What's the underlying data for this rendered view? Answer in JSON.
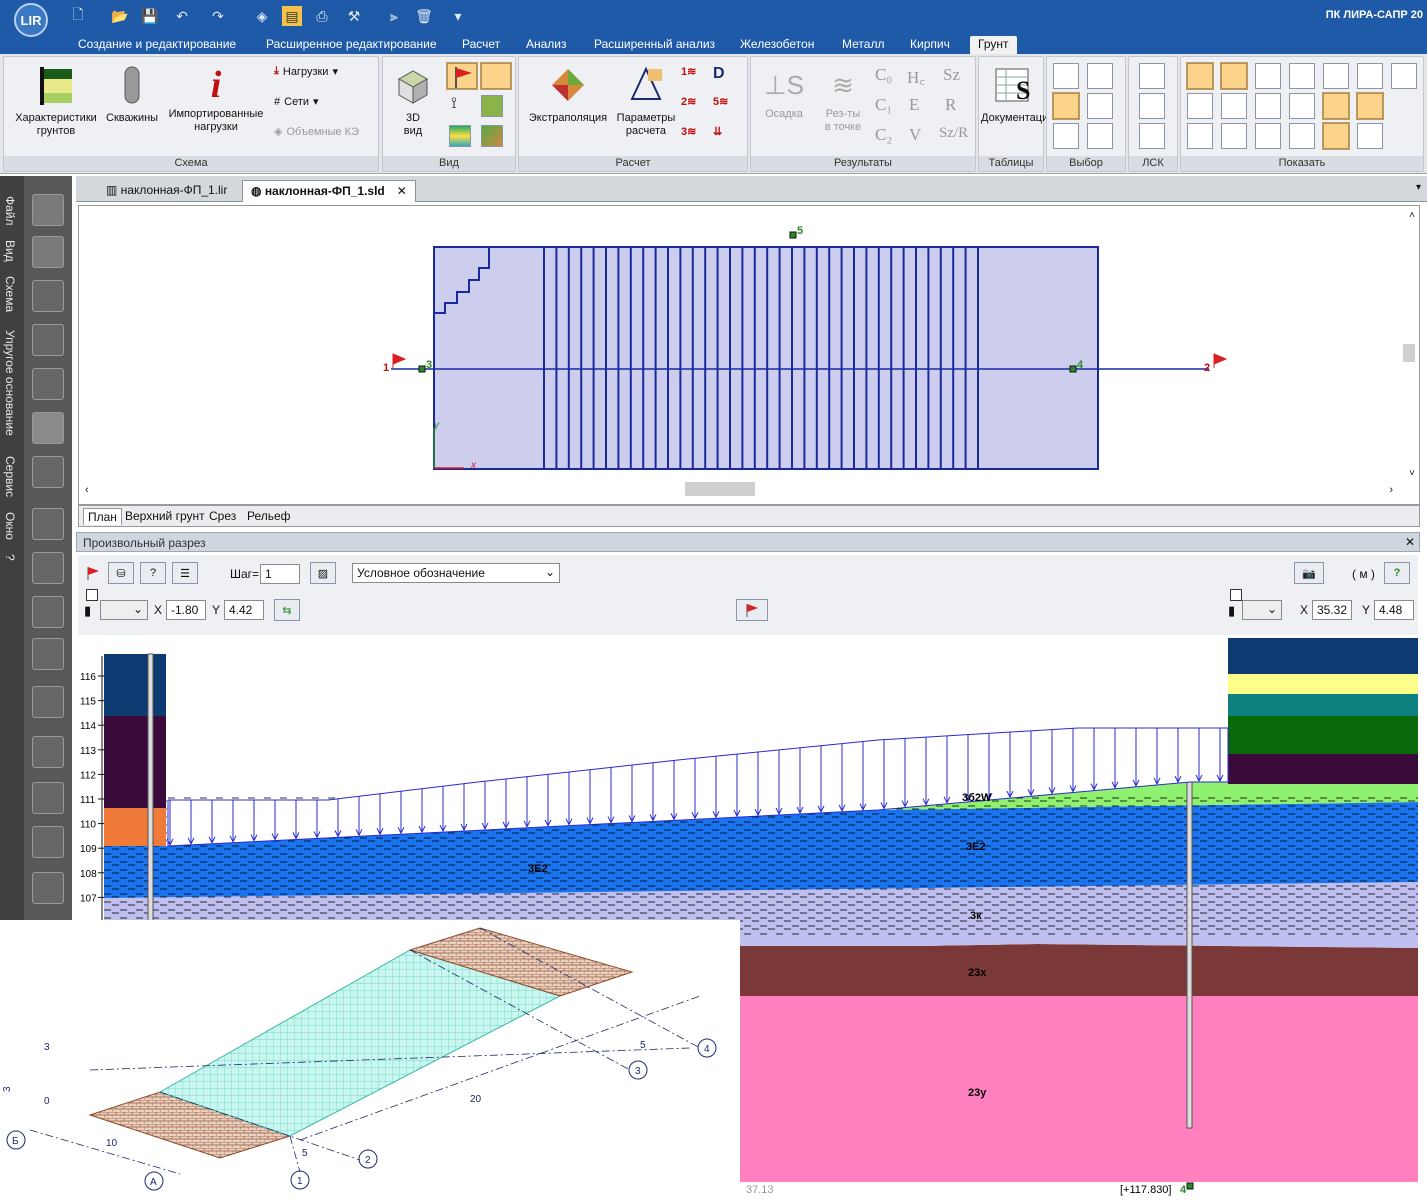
{
  "app": {
    "title": "ПК ЛИРА-САПР  20",
    "logo_text": "LIR"
  },
  "ribbon_tabs": [
    "Создание и редактирование",
    "Расширенное редактирование",
    "Расчет",
    "Анализ",
    "Расширенный анализ",
    "Железобетон",
    "Металл",
    "Кирпич",
    "Грунт"
  ],
  "ribbon": {
    "schema": {
      "label": "Схема",
      "char_soil": "Характеристики\nгрунтов",
      "wells": "Скважины",
      "imported_loads": "Импортированные\nнагрузки",
      "loads": "Нагрузки",
      "grids": "Сети",
      "volume_fe": "Объемные КЭ"
    },
    "view": {
      "label": "Вид",
      "view3d": "3D\nвид"
    },
    "calc": {
      "label": "Расчет",
      "extrapolation": "Экстраполяция",
      "calc_params": "Параметры\nрасчета"
    },
    "results": {
      "label": "Результаты",
      "settlement": "Осадка",
      "results_point": "Рез-ты\nв точке",
      "c0": "C₀",
      "c1": "C₁",
      "c2": "C₂",
      "hc": "H꜀",
      "e": "E",
      "v": "V",
      "sz": "Sz",
      "r": "R",
      "szr": "Sz/R"
    },
    "tables": {
      "label": "Таблицы",
      "documentation": "Документация"
    },
    "select": {
      "label": "Выбор"
    },
    "lsk": {
      "label": "ЛСК"
    },
    "show": {
      "label": "Показать"
    }
  },
  "left_menu": [
    "Файл",
    "Вид",
    "Схема",
    "Упругое основание",
    "Сервис",
    "Окно",
    "?"
  ],
  "doc_tabs": [
    {
      "label": "наклонная-ФП_1.lir"
    },
    {
      "label": "наклонная-ФП_1.sld"
    }
  ],
  "plan": {
    "markers": {
      "p1": "1",
      "p2": "2",
      "p3": "3",
      "p4": "4",
      "p5": "5"
    },
    "axis_x": "x",
    "axis_y": "y"
  },
  "plan_tabs": [
    "План",
    "Верхний грунт",
    "Срез",
    "Рельеф"
  ],
  "section": {
    "title": "Произвольный разрез",
    "step_label": "Шаг=",
    "step_value": "1",
    "legend_select": "Условное обозначение",
    "units": "( м )",
    "left_x_label": "X",
    "left_x": "-1.80",
    "left_y_label": "Y",
    "left_y": "4.42",
    "right_x_label": "X",
    "right_x": "35.32",
    "right_y_label": "Y",
    "right_y": "4.48",
    "y_ticks": [
      "116",
      "115",
      "114",
      "113",
      "112",
      "111",
      "110",
      "109",
      "108",
      "107"
    ],
    "layers": [
      "3б2W",
      "3E2",
      "3E2",
      "3к",
      "23х",
      "23у"
    ],
    "bottom_left": "37.13",
    "bottom_mark": "[+117.830]",
    "bottom_mark_num": "4"
  },
  "iso": {
    "dims": {
      "d3": "3",
      "d0": "0",
      "d3v": "3",
      "d10": "10",
      "d5a": "5",
      "d20": "20",
      "d5b": "5"
    },
    "axes": {
      "b": "Б",
      "a": "А",
      "n1": "1",
      "n2": "2",
      "n3": "3",
      "n4": "4"
    }
  },
  "colors": {
    "titlebar": "#1e5aa8",
    "plan_fill": "#cdcdee",
    "plan_line": "#1a2a9e",
    "load": "#2a2ad0",
    "l_dark": "#0d3a70",
    "l_yellow": "#fdfd8a",
    "l_teal": "#0d8080",
    "l_green": "#0a6a0a",
    "l_purple": "#3a0a3a",
    "l_orange": "#f07a3a",
    "l_blue": "#1a74f0",
    "l_lav": "#c0c0f0",
    "l_brown": "#7a3838",
    "l_pink": "#ff7fbf",
    "l_lgreen": "#90f070"
  }
}
